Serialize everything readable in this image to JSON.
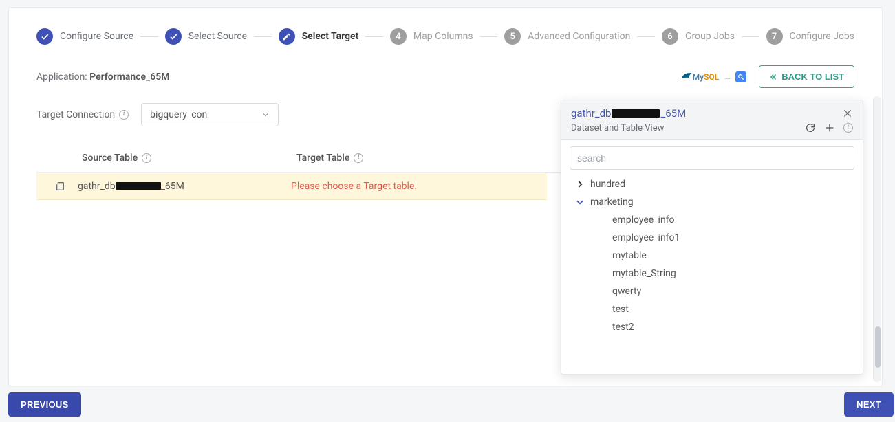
{
  "stepper": [
    {
      "label": "Configure Source",
      "state": "done"
    },
    {
      "label": "Select Source",
      "state": "done"
    },
    {
      "label": "Select Target",
      "state": "current"
    },
    {
      "num": "4",
      "label": "Map Columns",
      "state": "upcoming"
    },
    {
      "num": "5",
      "label": "Advanced Configuration",
      "state": "upcoming"
    },
    {
      "num": "6",
      "label": "Group Jobs",
      "state": "upcoming"
    },
    {
      "num": "7",
      "label": "Configure Jobs",
      "state": "upcoming"
    }
  ],
  "app": {
    "label_prefix": "Application: ",
    "name": "Performance_65M"
  },
  "back_button": "BACK TO LIST",
  "target_connection": {
    "label": "Target Connection",
    "value": "bigquery_con"
  },
  "table": {
    "headers": {
      "source": "Source Table",
      "target": "Target Table"
    },
    "row": {
      "source_prefix": "gathr_db",
      "source_suffix": "_65M",
      "target_message": "Please choose a Target table."
    }
  },
  "panel": {
    "title_prefix": "gathr_db",
    "title_suffix": "_65M",
    "subtitle": "Dataset and Table View",
    "search_placeholder": "search",
    "tree": {
      "collapsed": [
        "hundred"
      ],
      "expanded_parent": "marketing",
      "children": [
        "employee_info",
        "employee_info1",
        "mytable",
        "mytable_String",
        "qwerty",
        "test",
        "test2"
      ]
    }
  },
  "footer": {
    "previous": "PREVIOUS",
    "next": "NEXT"
  }
}
